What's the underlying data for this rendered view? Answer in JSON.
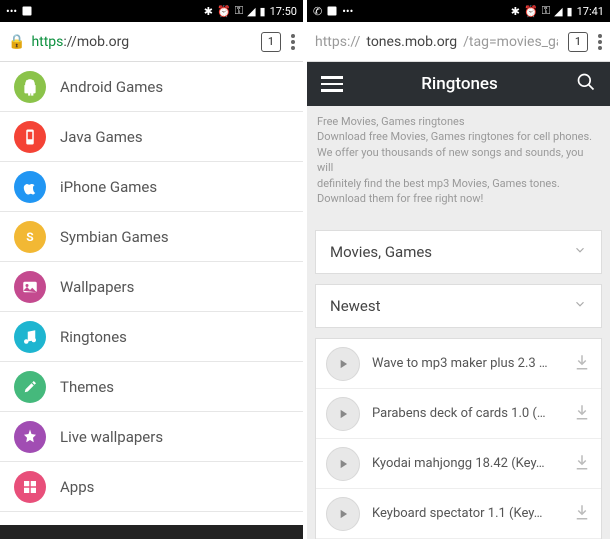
{
  "left": {
    "status": {
      "time": "17:50",
      "tabs": "1"
    },
    "url": {
      "scheme": "https",
      "host": "://mob.org"
    },
    "categories": [
      {
        "label": "Android Games",
        "icon": "android",
        "color": "#8bc34a"
      },
      {
        "label": "Java Games",
        "icon": "device",
        "color": "#f44336"
      },
      {
        "label": "iPhone Games",
        "icon": "apple",
        "color": "#2196f3"
      },
      {
        "label": "Symbian Games",
        "icon": "s",
        "color": "#f2b834"
      },
      {
        "label": "Wallpapers",
        "icon": "image",
        "color": "#c44a8f"
      },
      {
        "label": "Ringtones",
        "icon": "note",
        "color": "#1eb5d0"
      },
      {
        "label": "Themes",
        "icon": "brush",
        "color": "#45b97c"
      },
      {
        "label": "Live wallpapers",
        "icon": "star",
        "color": "#a14db3"
      },
      {
        "label": "Apps",
        "icon": "grid",
        "color": "#e84f7a"
      }
    ]
  },
  "right": {
    "status": {
      "time": "17:41",
      "tabs": "1"
    },
    "url": {
      "pre": "https://",
      "host": "tones.mob.org",
      "rest": "/tag=movies_gan"
    },
    "header": "Ringtones",
    "desc_lines": [
      "Free Movies, Games ringtones",
      "Download free Movies, Games ringtones for cell phones.",
      "We offer you thousands of new songs and sounds, you will",
      "definitely find the best mp3 Movies, Games tones.",
      "Download them for free right now!"
    ],
    "filter1": "Movies, Games",
    "filter2": "Newest",
    "tones": [
      {
        "title": "Wave to mp3 maker plus 2.3 …"
      },
      {
        "title": "Parabens deck of cards 1.0 (…"
      },
      {
        "title": "Kyodai mahjongg 18.42 (Key…"
      },
      {
        "title": "Keyboard spectator 1.1 (Key…"
      }
    ]
  }
}
